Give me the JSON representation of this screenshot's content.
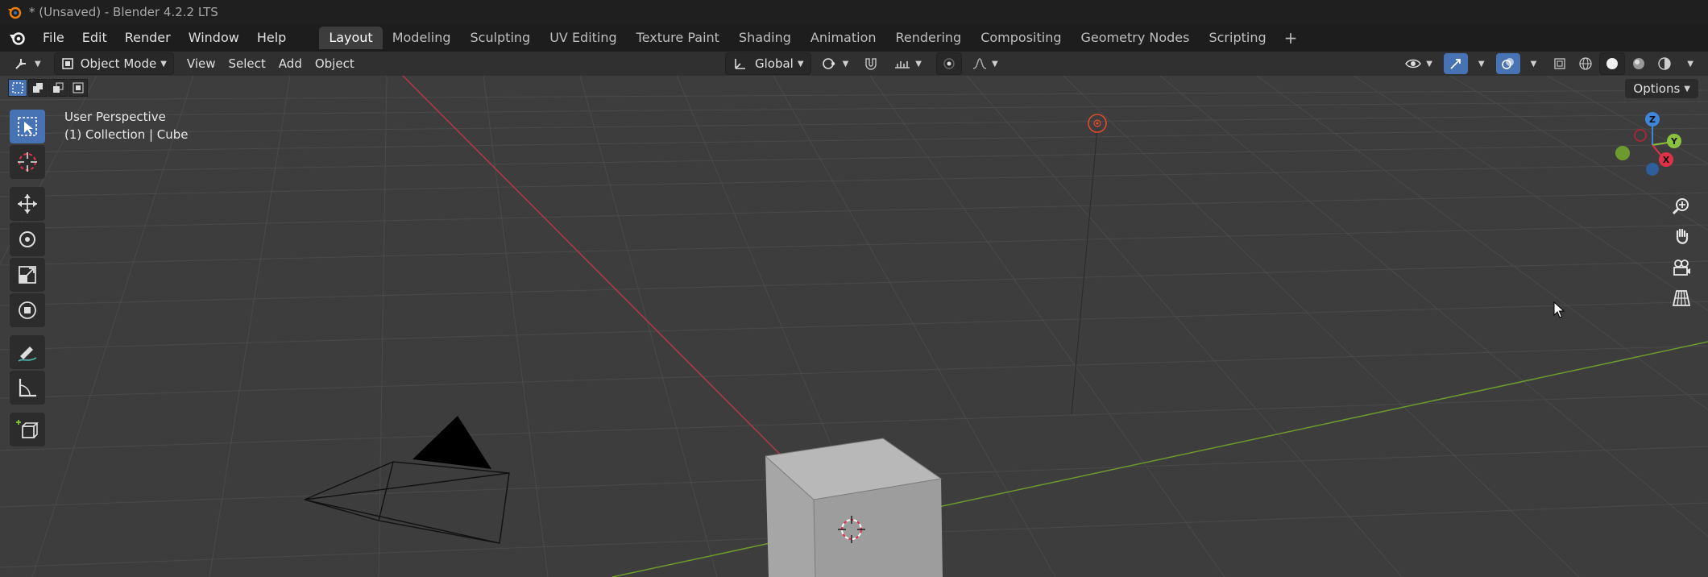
{
  "window": {
    "title": "* (Unsaved) - Blender 4.2.2 LTS"
  },
  "menu": {
    "items": [
      "File",
      "Edit",
      "Render",
      "Window",
      "Help"
    ]
  },
  "workspaces": {
    "tabs": [
      "Layout",
      "Modeling",
      "Sculpting",
      "UV Editing",
      "Texture Paint",
      "Shading",
      "Animation",
      "Rendering",
      "Compositing",
      "Geometry Nodes",
      "Scripting"
    ],
    "active": "Layout",
    "add_icon": "plus-icon"
  },
  "header": {
    "mode": "Object Mode",
    "menus": [
      "View",
      "Select",
      "Add",
      "Object"
    ],
    "transform_orientation": "Global"
  },
  "viewport": {
    "options_label": "Options",
    "perspective_label": "User Perspective",
    "collection_label": "(1) Collection | Cube",
    "gizmo_axes": [
      "Z",
      "Y",
      "X"
    ]
  },
  "toolbar": {
    "tools": [
      "select-box-icon",
      "cursor-icon",
      "move-icon",
      "rotate-icon",
      "scale-icon",
      "transform-icon",
      "annotate-icon",
      "measure-icon",
      "add-cube-icon"
    ],
    "active_tool": "select-box-icon"
  },
  "colors": {
    "accent": "#4772b3",
    "x_axis": "#e0314b",
    "y_axis": "#8ac23f",
    "z_axis": "#3f86d8",
    "background": "#3d3d3d"
  }
}
